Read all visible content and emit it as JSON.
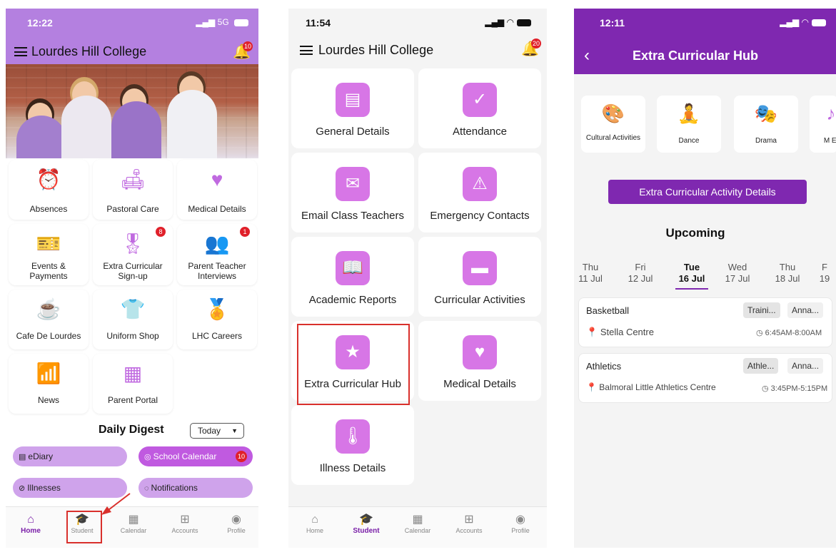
{
  "phone1": {
    "time": "12:22",
    "network": "5G",
    "title": "Lourdes Hill College",
    "bell_badge": "10",
    "tiles": [
      {
        "label": "Absences",
        "icon": "alarm-clock-icon"
      },
      {
        "label": "Pastoral Care",
        "icon": "lamp-icon"
      },
      {
        "label": "Medical Details",
        "icon": "heart-icon"
      },
      {
        "label": "Events & Payments",
        "icon": "ticket-icon"
      },
      {
        "label": "Extra Curricular Sign-up",
        "icon": "ribbon-icon",
        "badge": "8"
      },
      {
        "label": "Parent Teacher Interviews",
        "icon": "people-icon",
        "badge": "1"
      },
      {
        "label": "Cafe De Lourdes",
        "icon": "coffee-cup-icon"
      },
      {
        "label": "Uniform Shop",
        "icon": "shirt-icon"
      },
      {
        "label": "LHC Careers",
        "icon": "badge-icon"
      },
      {
        "label": "News",
        "icon": "rss-icon"
      },
      {
        "label": "Parent Portal",
        "icon": "grid-plus-icon"
      }
    ],
    "digest": {
      "title": "Daily Digest",
      "filter": "Today",
      "pills": [
        {
          "label": "eDiary"
        },
        {
          "label": "School Calendar",
          "badge": "10"
        },
        {
          "label": "Illnesses"
        },
        {
          "label": "Notifications"
        }
      ]
    },
    "tabs": [
      "Home",
      "Student",
      "Calendar",
      "Accounts",
      "Profile"
    ]
  },
  "phone2": {
    "time": "11:54",
    "title": "Lourdes Hill College",
    "bell_badge": "20",
    "tiles": [
      {
        "label": "General Details",
        "icon": "id-card-icon"
      },
      {
        "label": "Attendance",
        "icon": "clipboard-check-icon"
      },
      {
        "label": "Email Class Teachers",
        "icon": "envelope-icon"
      },
      {
        "label": "Emergency Contacts",
        "icon": "siren-icon"
      },
      {
        "label": "Academic Reports",
        "icon": "open-book-icon"
      },
      {
        "label": "Curricular Activities",
        "icon": "book-icon"
      },
      {
        "label": "Extra Curricular Hub",
        "icon": "ribbon-icon"
      },
      {
        "label": "Medical Details",
        "icon": "heart-icon"
      },
      {
        "label": "Illness Details",
        "icon": "thermometer-icon"
      }
    ],
    "tabs": [
      "Home",
      "Student",
      "Calendar",
      "Accounts",
      "Profile"
    ]
  },
  "phone3": {
    "time": "12:11",
    "title": "Extra Curricular Hub",
    "categories": [
      {
        "label": "Cultural Activities",
        "icon": "palette-icon"
      },
      {
        "label": "Dance",
        "icon": "meditation-icon"
      },
      {
        "label": "Drama",
        "icon": "theatre-masks-icon"
      },
      {
        "label": "M Ens",
        "icon": "music-note-icon"
      }
    ],
    "details_button": "Extra Curricular Activity Details",
    "upcoming": "Upcoming",
    "days": [
      {
        "dow": "Thu",
        "date": "11 Jul"
      },
      {
        "dow": "Fri",
        "date": "12 Jul"
      },
      {
        "dow": "Tue",
        "date": "16 Jul"
      },
      {
        "dow": "Wed",
        "date": "17 Jul"
      },
      {
        "dow": "Thu",
        "date": "18 Jul"
      },
      {
        "dow": "F",
        "date": "19"
      }
    ],
    "events": [
      {
        "name": "Basketball",
        "tag1": "Traini...",
        "tag2": "Anna...",
        "location": "Stella Centre",
        "time": "6:45AM-8:00AM"
      },
      {
        "name": "Athletics",
        "tag1": "Athle...",
        "tag2": "Anna...",
        "location": "Balmoral Little Athletics Centre",
        "time": "3:45PM-5:15PM"
      }
    ]
  },
  "colors": {
    "brand_purple": "#7f28b0",
    "light_purple": "#b480e0",
    "icon_pink": "#d776e6",
    "badge_red": "#e0202a",
    "highlight_red": "#d9302c"
  }
}
